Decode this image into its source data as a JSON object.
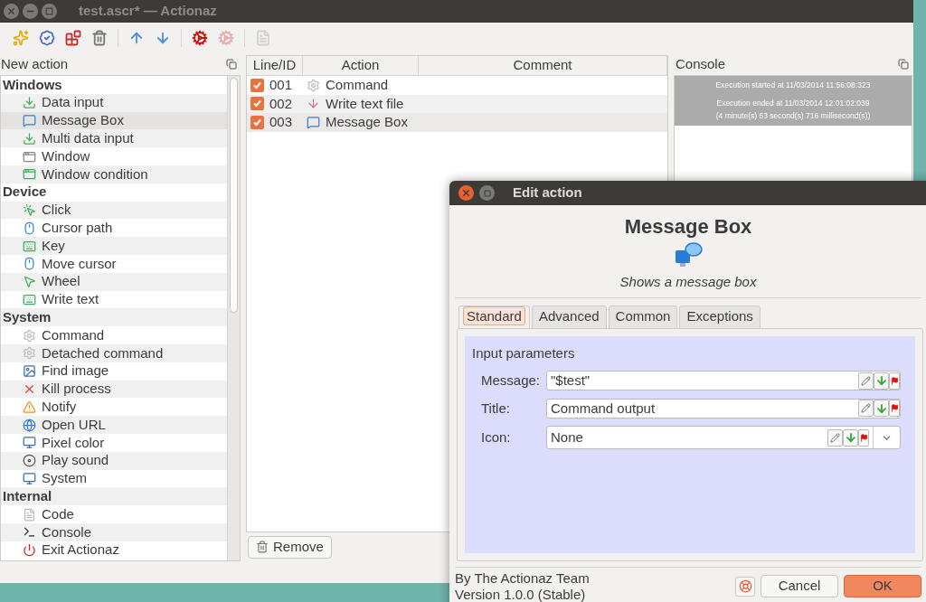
{
  "window": {
    "title": "test.ascr* — Actionaz"
  },
  "toolbar": [
    {
      "disabled": false
    },
    {
      "disabled": false
    },
    {
      "disabled": false
    },
    {
      "disabled": false
    },
    {
      "disabled": false
    },
    {
      "disabled": false
    },
    {
      "disabled": false
    },
    {
      "disabled": true
    },
    {
      "disabled": true
    }
  ],
  "new_action": {
    "title": "New action",
    "groups": [
      {
        "label": "Windows",
        "items": [
          {
            "label": "Data input",
            "selected": false
          },
          {
            "label": "Message Box",
            "selected": true
          },
          {
            "label": "Multi data input",
            "selected": false
          },
          {
            "label": "Window",
            "selected": false
          },
          {
            "label": "Window condition",
            "selected": false
          }
        ]
      },
      {
        "label": "Device",
        "items": [
          {
            "label": "Click",
            "selected": false
          },
          {
            "label": "Cursor path",
            "selected": false
          },
          {
            "label": "Key",
            "selected": false
          },
          {
            "label": "Move cursor",
            "selected": false
          },
          {
            "label": "Wheel",
            "selected": false
          },
          {
            "label": "Write text",
            "selected": false
          }
        ]
      },
      {
        "label": "System",
        "items": [
          {
            "label": "Command",
            "selected": false
          },
          {
            "label": "Detached command",
            "selected": false
          },
          {
            "label": "Find image",
            "selected": false
          },
          {
            "label": "Kill process",
            "selected": false
          },
          {
            "label": "Notify",
            "selected": false
          },
          {
            "label": "Open URL",
            "selected": false
          },
          {
            "label": "Pixel color",
            "selected": false
          },
          {
            "label": "Play sound",
            "selected": false
          },
          {
            "label": "System",
            "selected": false
          }
        ]
      },
      {
        "label": "Internal",
        "items": [
          {
            "label": "Code",
            "selected": false
          },
          {
            "label": "Console",
            "selected": false
          },
          {
            "label": "Exit Actionaz",
            "selected": false
          }
        ]
      }
    ]
  },
  "script_table": {
    "columns": [
      "Line/ID",
      "Action",
      "Comment"
    ],
    "rows": [
      {
        "checked": true,
        "id": "001",
        "action": "Command",
        "selected": false
      },
      {
        "checked": true,
        "id": "002",
        "action": "Write text file",
        "selected": false
      },
      {
        "checked": true,
        "id": "003",
        "action": "Message Box",
        "selected": true
      }
    ],
    "remove_button": "Remove"
  },
  "console": {
    "title": "Console",
    "lines": [
      "Execution started at 11/03/2014 11:56:08:323",
      "Execution ended at 11/03/2014 12:01:02:039",
      "(4 minute(s) 53 second(s) 716 millisecond(s))"
    ]
  },
  "dialog": {
    "title": "Edit action",
    "heading": "Message Box",
    "subtitle": "Shows a message box",
    "tabs": [
      {
        "label": "Standard",
        "selected": true
      },
      {
        "label": "Advanced",
        "selected": false
      },
      {
        "label": "Common",
        "selected": false
      },
      {
        "label": "Exceptions",
        "selected": false
      }
    ],
    "group_title": "Input parameters",
    "fields": [
      {
        "kind": "text",
        "label": "Message:",
        "value": "\"$test\""
      },
      {
        "kind": "text",
        "label": "Title:",
        "value": "Command output"
      },
      {
        "kind": "combo",
        "label": "Icon:",
        "value": "None"
      }
    ],
    "footer": [
      "By The Actionaz Team",
      "Version 1.0.0 (Stable)"
    ],
    "buttons": [
      {
        "label": "Cancel",
        "primary": false
      },
      {
        "label": "OK",
        "primary": true
      }
    ]
  }
}
